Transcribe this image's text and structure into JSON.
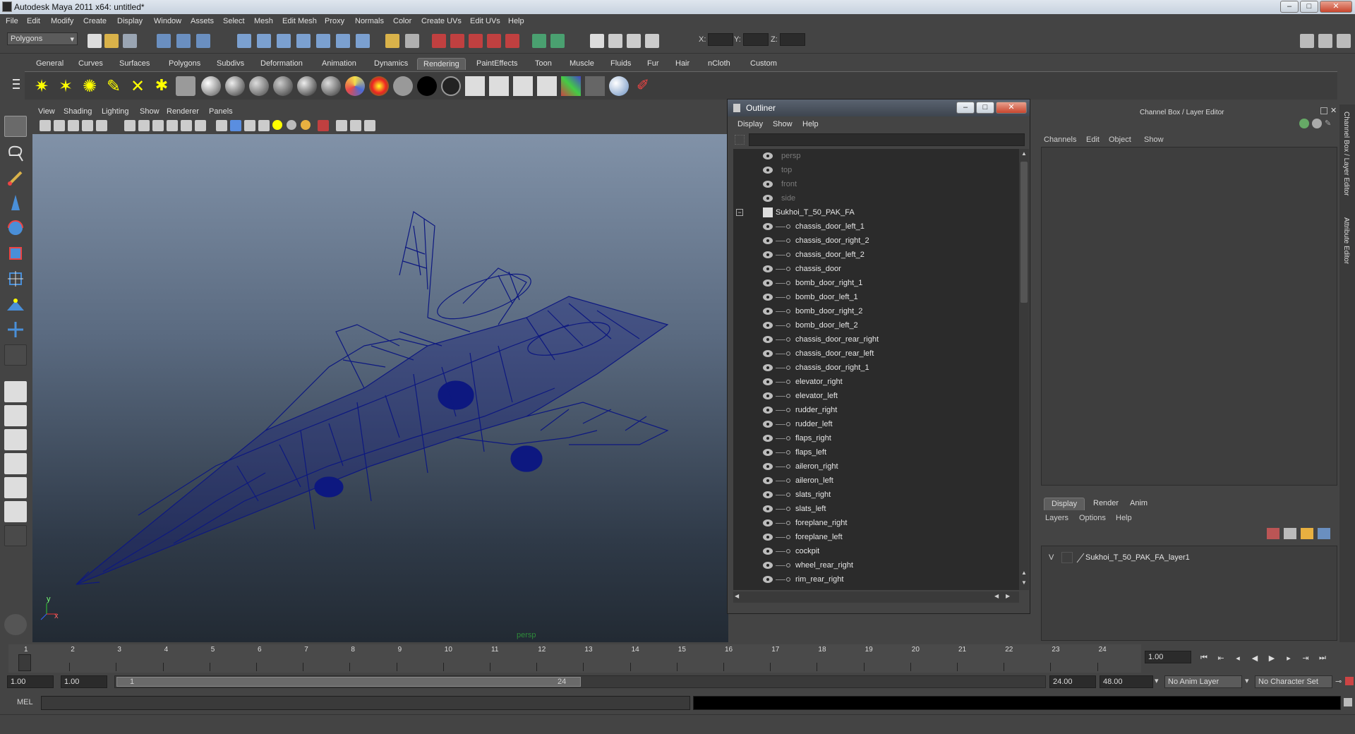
{
  "window": {
    "title": "Autodesk Maya 2011 x64: untitled*",
    "min": "–",
    "max": "□",
    "close": "✕"
  },
  "menus": [
    "File",
    "Edit",
    "Modify",
    "Create",
    "Display",
    "Window",
    "Assets",
    "Select",
    "Mesh",
    "Edit Mesh",
    "Proxy",
    "Normals",
    "Color",
    "Create UVs",
    "Edit UVs",
    "Help"
  ],
  "status": {
    "menuset": "Polygons",
    "x_label": "X:",
    "y_label": "Y:",
    "z_label": "Z:"
  },
  "shelf_tabs": [
    "General",
    "Curves",
    "Surfaces",
    "Polygons",
    "Subdivs",
    "Deformation",
    "Animation",
    "Dynamics",
    "Rendering",
    "PaintEffects",
    "Toon",
    "Muscle",
    "Fluids",
    "Fur",
    "Hair",
    "nCloth",
    "Custom"
  ],
  "active_shelf": "Rendering",
  "viewport": {
    "menus": [
      "View",
      "Shading",
      "Lighting",
      "Show",
      "Renderer",
      "Panels"
    ],
    "camera_label": "persp",
    "axis_y": "y",
    "axis_x": "x"
  },
  "outliner": {
    "title": "Outliner",
    "menus": [
      "Display",
      "Show",
      "Help"
    ],
    "cameras": [
      "persp",
      "top",
      "front",
      "side"
    ],
    "root": "Sukhoi_T_50_PAK_FA",
    "children": [
      "chassis_door_left_1",
      "chassis_door_right_2",
      "chassis_door_left_2",
      "chassis_door",
      "bomb_door_right_1",
      "bomb_door_left_1",
      "bomb_door_right_2",
      "bomb_door_left_2",
      "chassis_door_rear_right",
      "chassis_door_rear_left",
      "chassis_door_right_1",
      "elevator_right",
      "elevator_left",
      "rudder_right",
      "rudder_left",
      "flaps_right",
      "flaps_left",
      "aileron_right",
      "aileron_left",
      "slats_right",
      "slats_left",
      "foreplane_right",
      "foreplane_left",
      "cockpit",
      "wheel_rear_right",
      "rim_rear_right"
    ]
  },
  "channel_box": {
    "title": "Channel Box / Layer Editor",
    "menus": [
      "Channels",
      "Edit",
      "Object",
      "Show"
    ],
    "layer_tabs": [
      "Display",
      "Render",
      "Anim"
    ],
    "layer_menus": [
      "Layers",
      "Options",
      "Help"
    ],
    "layer": {
      "visibility": "V",
      "name": "Sukhoi_T_50_PAK_FA_layer1"
    },
    "side_tabs": [
      "Channel Box / Layer Editor",
      "Attribute Editor"
    ]
  },
  "timeline": {
    "ticks": [
      "1",
      "2",
      "3",
      "4",
      "5",
      "6",
      "7",
      "8",
      "9",
      "10",
      "11",
      "12",
      "13",
      "14",
      "15",
      "16",
      "17",
      "18",
      "19",
      "20",
      "21",
      "22",
      "23",
      "24"
    ],
    "current_frame": "1.00",
    "start": "1.00",
    "playback_start": "1.00",
    "range_start_label": "1",
    "range_end_label": "24",
    "playback_end": "24.00",
    "end": "48.00",
    "anim_layer": "No Anim Layer",
    "character_set": "No Character Set"
  },
  "cmd": {
    "label": "MEL"
  }
}
